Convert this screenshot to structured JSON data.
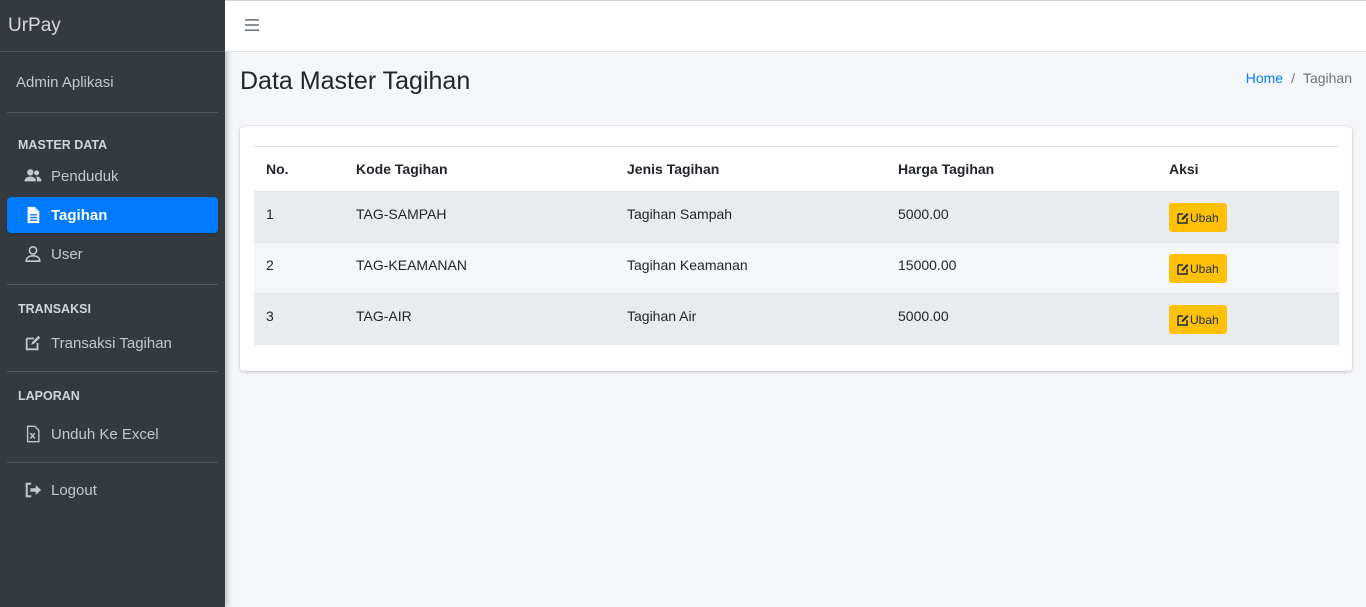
{
  "brand": "UrPay",
  "user_name": "Admin Aplikasi",
  "sidebar": {
    "sections": [
      {
        "header": "MASTER DATA",
        "items": [
          {
            "label": "Penduduk",
            "icon": "users-icon",
            "active": false
          },
          {
            "label": "Tagihan",
            "icon": "file-text-icon",
            "active": true
          },
          {
            "label": "User",
            "icon": "user-icon",
            "active": false
          }
        ]
      },
      {
        "header": "TRANSAKSI",
        "items": [
          {
            "label": "Transaksi Tagihan",
            "icon": "edit-icon",
            "active": false
          }
        ]
      },
      {
        "header": "LAPORAN",
        "items": [
          {
            "label": "Unduh Ke Excel",
            "icon": "file-excel-icon",
            "active": false
          }
        ]
      }
    ],
    "logout": "Logout"
  },
  "topbar": {
    "menu_icon": "hamburger-icon"
  },
  "page": {
    "title": "Data Master Tagihan",
    "breadcrumb": {
      "home": "Home",
      "separator": "/",
      "current": "Tagihan"
    }
  },
  "table": {
    "headers": [
      "No.",
      "Kode Tagihan",
      "Jenis Tagihan",
      "Harga Tagihan",
      "Aksi"
    ],
    "rows": [
      {
        "no": "1",
        "kode": "TAG-SAMPAH",
        "jenis": "Tagihan Sampah",
        "harga": "5000.00",
        "aksi": "Ubah"
      },
      {
        "no": "2",
        "kode": "TAG-KEAMANAN",
        "jenis": "Tagihan Keamanan",
        "harga": "15000.00",
        "aksi": "Ubah"
      },
      {
        "no": "3",
        "kode": "TAG-AIR",
        "jenis": "Tagihan Air",
        "harga": "5000.00",
        "aksi": "Ubah"
      }
    ]
  },
  "colors": {
    "sidebar_bg": "#343a40",
    "active": "#007bff",
    "warning_button": "#ffc107",
    "content_bg": "#f4f6f9"
  }
}
